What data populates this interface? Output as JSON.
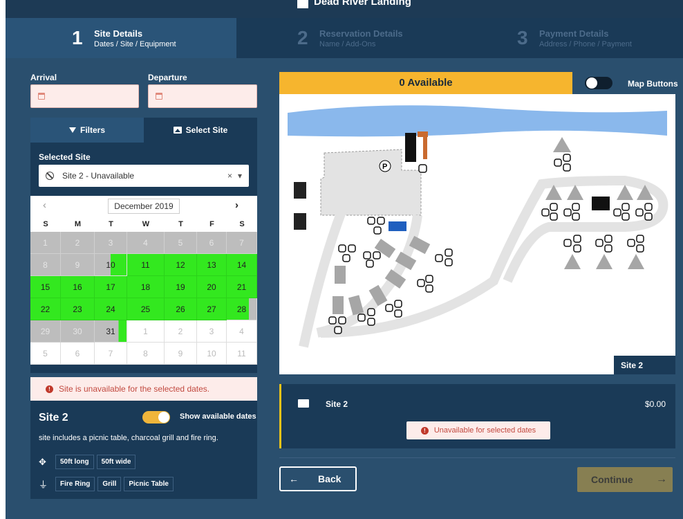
{
  "park_title": "Dead River Landing",
  "steps": [
    {
      "number": "1",
      "title": "Site Details",
      "subtitle": "Dates / Site / Equipment"
    },
    {
      "number": "2",
      "title": "Reservation Details",
      "subtitle": "Name / Add-Ons"
    },
    {
      "number": "3",
      "title": "Payment Details",
      "subtitle": "Address / Phone / Payment"
    }
  ],
  "arrival": {
    "label": "Arrival",
    "value": ""
  },
  "departure": {
    "label": "Departure",
    "value": ""
  },
  "tabs": {
    "filters": "Filters",
    "select_site": "Select Site"
  },
  "selected_site": {
    "label": "Selected Site",
    "value": "Site 2 - Unavailable",
    "clear": "×",
    "caret": "▾"
  },
  "calendar": {
    "month": "December 2019",
    "prev": "‹",
    "next": "›",
    "dow": [
      "S",
      "M",
      "T",
      "W",
      "T",
      "F",
      "S"
    ],
    "weeks": [
      [
        "1",
        "2",
        "3",
        "4",
        "5",
        "6",
        "7"
      ],
      [
        "8",
        "9",
        "10",
        "11",
        "12",
        "13",
        "14"
      ],
      [
        "15",
        "16",
        "17",
        "18",
        "19",
        "20",
        "21"
      ],
      [
        "22",
        "23",
        "24",
        "25",
        "26",
        "27",
        "28"
      ],
      [
        "29",
        "30",
        "31",
        "1",
        "2",
        "3",
        "4"
      ],
      [
        "5",
        "6",
        "7",
        "8",
        "9",
        "10",
        "11"
      ]
    ]
  },
  "error_message": "Site is unavailable for the selected dates.",
  "site": {
    "name": "Site 2",
    "show_available_label": "Show available dates",
    "description": "site includes a picnic table, charcoal grill and fire ring.",
    "dimensions": [
      "50ft long",
      "50ft wide"
    ],
    "amenities": [
      "Fire Ring",
      "Grill",
      "Picnic Table"
    ]
  },
  "availability": "0 Available",
  "map_buttons_label": "Map Buttons",
  "map": {
    "parking_label": "P",
    "site_label": "Site 2"
  },
  "detail": {
    "name": "Site 2",
    "price": "$0.00",
    "status": "Unavailable for selected dates"
  },
  "buttons": {
    "back": "Back",
    "continue": "Continue"
  },
  "colors": {
    "accent": "#f6b52e",
    "available": "#33e81f",
    "unavailable": "#bdbdbd",
    "error": "#c0392b"
  }
}
